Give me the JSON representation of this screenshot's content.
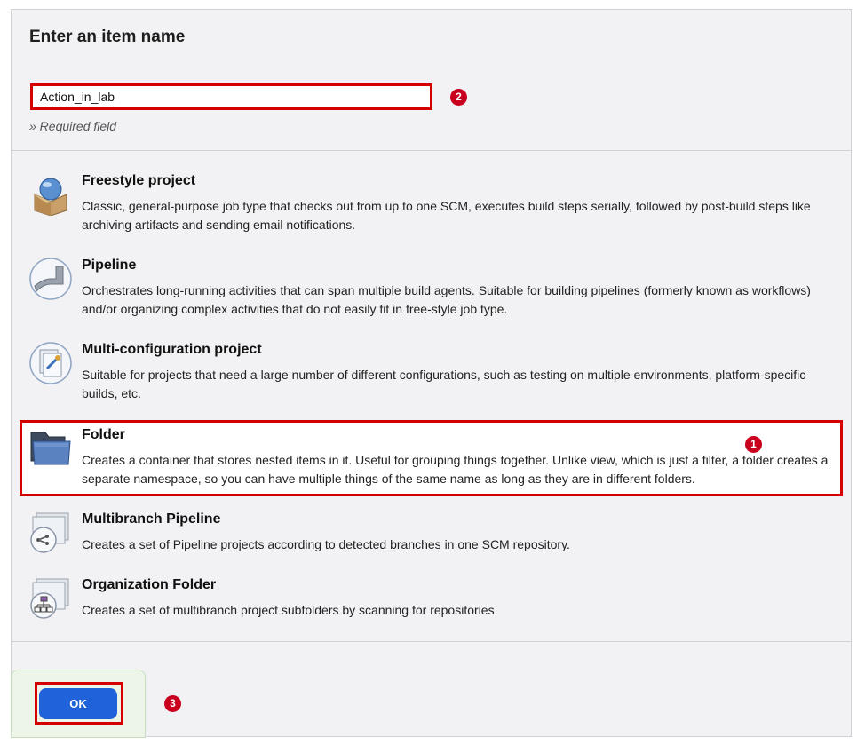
{
  "header": {
    "title": "Enter an item name"
  },
  "name_field": {
    "value": "Action_in_lab",
    "hint": "» Required field"
  },
  "item_types": [
    {
      "title": "Freestyle project",
      "description": "Classic, general-purpose job type that checks out from up to one SCM, executes build steps serially, followed by post-build steps like archiving artifacts and sending email notifications.",
      "icon": "freestyle-project-icon"
    },
    {
      "title": "Pipeline",
      "description": "Orchestrates long-running activities that can span multiple build agents. Suitable for building pipelines (formerly known as workflows) and/or organizing complex activities that do not easily fit in free-style job type.",
      "icon": "pipeline-icon"
    },
    {
      "title": "Multi-configuration project",
      "description": "Suitable for projects that need a large number of different configurations, such as testing on multiple environments, platform-specific builds, etc.",
      "icon": "multi-configuration-icon"
    },
    {
      "title": "Folder",
      "description": "Creates a container that stores nested items in it. Useful for grouping things together. Unlike view, which is just a filter, a folder creates a separate namespace, so you can have multiple things of the same name as long as they are in different folders.",
      "icon": "folder-icon",
      "selected": true
    },
    {
      "title": "Multibranch Pipeline",
      "description": "Creates a set of Pipeline projects according to detected branches in one SCM repository.",
      "icon": "multibranch-pipeline-icon"
    },
    {
      "title": "Organization Folder",
      "description": "Creates a set of multibranch project subfolders by scanning for repositories.",
      "icon": "organization-folder-icon"
    }
  ],
  "actions": {
    "ok_label": "OK"
  },
  "step_markers": {
    "folder": "1",
    "name_input": "2",
    "ok_button": "3"
  },
  "colors": {
    "highlight": "#d40000",
    "marker": "#c8001e",
    "ok_button": "#1f62d9",
    "panel_bg": "#f2f2f4"
  }
}
